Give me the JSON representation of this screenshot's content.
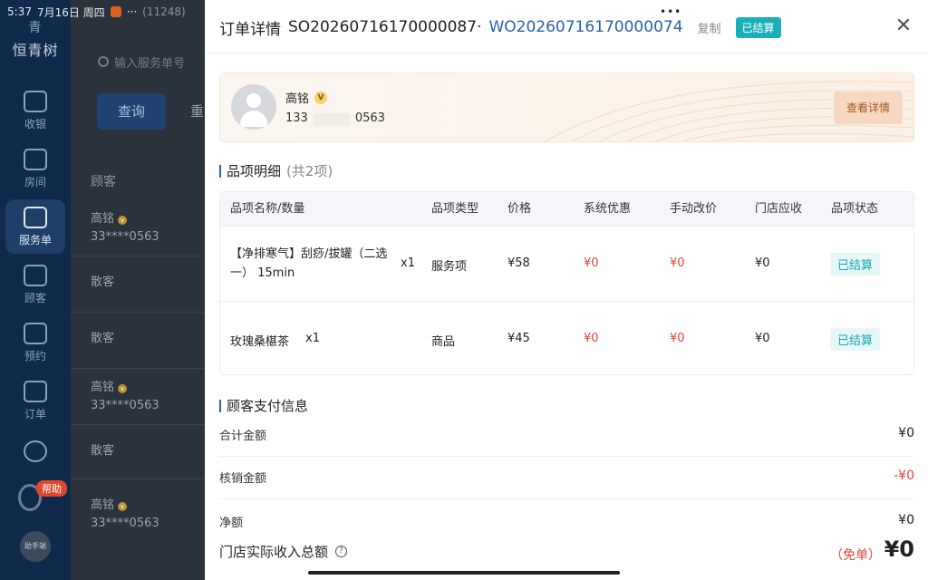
{
  "status_bar": {
    "time": "5:37",
    "date": "7月16日 周四",
    "dots": "···",
    "count": "(11248)"
  },
  "sidebar": {
    "brand": "恒青树",
    "brand_mark": "青",
    "items": [
      {
        "label": "收银",
        "icon": "cashier-icon"
      },
      {
        "label": "房间",
        "icon": "room-icon"
      },
      {
        "label": "服务单",
        "icon": "service-order-icon"
      },
      {
        "label": "顾客",
        "icon": "customer-icon"
      },
      {
        "label": "预约",
        "icon": "calendar-icon"
      },
      {
        "label": "订单",
        "icon": "order-icon"
      }
    ],
    "help_badge": "帮助",
    "assistant_label": "助手端"
  },
  "background": {
    "search_placeholder": "输入服务单号",
    "query_label": "查询",
    "query2_label": "重",
    "header": "顾客",
    "rows": [
      {
        "line1": "高铭",
        "line2": "33****0563"
      },
      {
        "line1": "散客",
        "line2": ""
      },
      {
        "line1": "散客",
        "line2": ""
      },
      {
        "line1": "高铭",
        "line2": "33****0563"
      },
      {
        "line1": "散客",
        "line2": ""
      },
      {
        "line1": "高铭",
        "line2": "33****0563"
      }
    ]
  },
  "drawer": {
    "drag_dots": "•••",
    "title": "订单详情",
    "so_number": "SO20260716170000087",
    "separator": "·",
    "wo_number": "WO20260716170000074",
    "copy_label": "复制",
    "status": "已结算",
    "close_icon": "close-icon",
    "customer": {
      "name": "高铭",
      "vip": "V",
      "phone_prefix": "133",
      "phone_suffix": "0563",
      "detail_button": "查看详情"
    },
    "items_section": {
      "title": "品项明细",
      "count": "(共2项)",
      "headers": [
        "品项名称/数量",
        "品项类型",
        "价格",
        "系统优惠",
        "手动改价",
        "门店应收",
        "品项状态"
      ],
      "rows": [
        {
          "name": "【净排寒气】刮痧/拔罐（二选一） 15min",
          "qty": "x1",
          "type": "服务项",
          "price": "¥58",
          "system_discount": "¥0",
          "manual_change": "¥0",
          "receivable": "¥0",
          "status": "已结算"
        },
        {
          "name": "玫瑰桑椹茶",
          "qty": "x1",
          "type": "商品",
          "price": "¥45",
          "system_discount": "¥0",
          "manual_change": "¥0",
          "receivable": "¥0",
          "status": "已结算"
        }
      ]
    },
    "payment_section": {
      "title": "顾客支付信息",
      "rows": [
        {
          "label": "合计金额",
          "value": "¥0"
        },
        {
          "label": "核销金额",
          "value": "-¥0"
        },
        {
          "label": "净额",
          "value": "¥0"
        }
      ]
    },
    "footer": {
      "label": "门店实际收入总额",
      "tag": "（免单）",
      "total": "¥0"
    }
  },
  "colors": {
    "nav_bg": "#0f2a4a",
    "link_blue": "#2563a8",
    "status_teal": "#1bb0b8",
    "red": "#e0443a",
    "detail_btn_bg": "#f6d7bf"
  }
}
